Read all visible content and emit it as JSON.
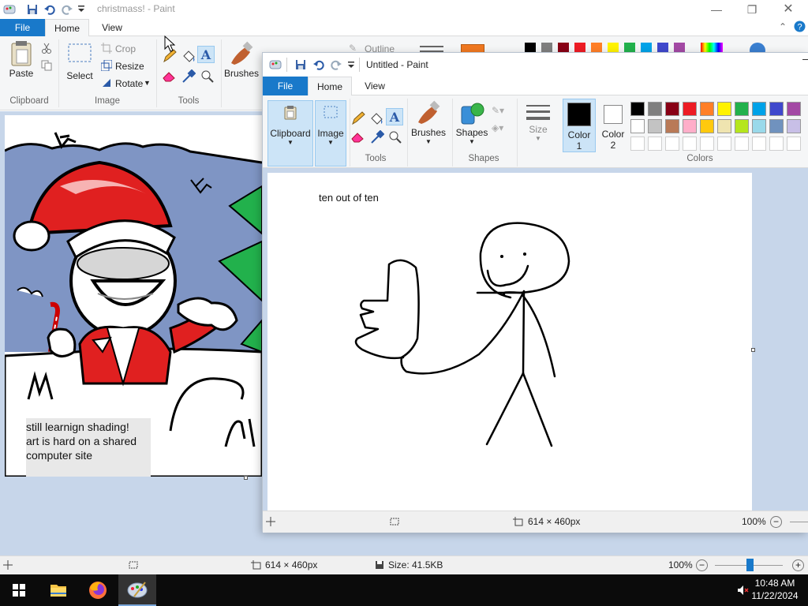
{
  "bg_window": {
    "title": "christmass! - Paint",
    "tabs": {
      "file": "File",
      "home": "Home",
      "view": "View"
    },
    "ribbon": {
      "clipboard": {
        "paste": "Paste",
        "group": "Clipboard"
      },
      "image": {
        "select": "Select",
        "crop": "Crop",
        "resize": "Resize",
        "rotate": "Rotate",
        "group": "Image"
      },
      "tools": {
        "group": "Tools"
      },
      "brushes": {
        "label": "Brushes"
      },
      "outline": "Outline"
    },
    "canvas_text": [
      "still learnign shading!",
      "art is hard on a shared",
      "computer site"
    ],
    "status": {
      "dimensions": "614 × 460px",
      "size": "Size: 41.5KB",
      "zoom": "100%"
    }
  },
  "fg_window": {
    "title": "Untitled - Paint",
    "tabs": {
      "file": "File",
      "home": "Home",
      "view": "View"
    },
    "ribbon": {
      "clipboard": "Clipboard",
      "image": "Image",
      "tools_group": "Tools",
      "brushes": "Brushes",
      "shapes": "Shapes",
      "shapes_group": "Shapes",
      "size": "Size",
      "color1_line1": "Color",
      "color1_line2": "1",
      "color2_line1": "Color",
      "color2_line2": "2",
      "colors_group": "Colors"
    },
    "canvas_text": "ten out of ten",
    "status": {
      "dimensions": "614 × 460px",
      "zoom": "100%"
    }
  },
  "palette": {
    "row1": [
      "#000000",
      "#7f7f7f",
      "#880015",
      "#ed1c24",
      "#ff7f27",
      "#fff200",
      "#22b14c",
      "#00a2e8",
      "#3f48cc",
      "#a349a4"
    ],
    "row2": [
      "#ffffff",
      "#c3c3c3",
      "#b97a57",
      "#ffaec9",
      "#ffc90e",
      "#efe4b0",
      "#b5e61d",
      "#99d9ea",
      "#7092be",
      "#c8bfe7"
    ]
  },
  "taskbar": {
    "time": "10:48 AM",
    "date": "11/22/2024"
  }
}
